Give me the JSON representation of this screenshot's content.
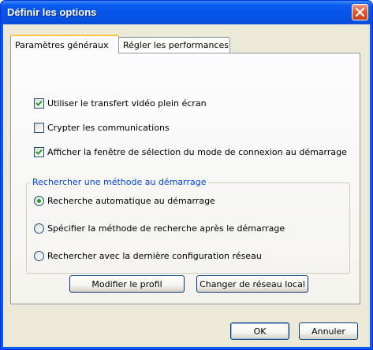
{
  "window": {
    "title": "Définir les options"
  },
  "tabs": [
    {
      "label": "Paramètres généraux",
      "active": true
    },
    {
      "label": "Régler les performances",
      "active": false
    }
  ],
  "options": {
    "fullscreen_video": {
      "label": "Utiliser le transfert vidéo plein écran",
      "checked": true
    },
    "encrypt": {
      "label": "Crypter les communications",
      "checked": false
    },
    "show_connection_mode": {
      "label": "Afficher la fenêtre de sélection du mode de connexion au démarrage",
      "checked": true
    }
  },
  "search_group": {
    "legend": "Rechercher une méthode au démarrage",
    "radios": [
      {
        "label": "Recherche automatique au démarrage",
        "selected": true
      },
      {
        "label": "Spécifier la méthode de recherche après le démarrage",
        "selected": false
      },
      {
        "label": "Rechercher avec la dernière configuration réseau",
        "selected": false
      }
    ]
  },
  "buttons": {
    "edit_profile": "Modifier le profil",
    "change_lan": "Changer de réseau local",
    "ok": "OK",
    "cancel": "Annuler"
  },
  "colors": {
    "titlebar": "#0a5bf0",
    "dialog_face": "#ece9d8",
    "group_legend": "#0046d5",
    "radio_dot": "#21a121",
    "check_mark": "#21a121"
  }
}
